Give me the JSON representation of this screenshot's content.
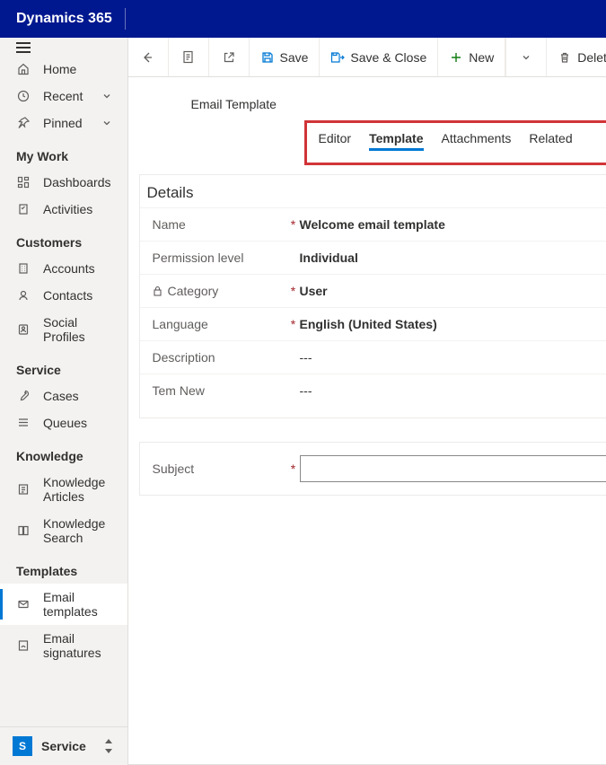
{
  "app_title": "Dynamics 365",
  "sidebar": {
    "top": [
      {
        "label": "Home"
      },
      {
        "label": "Recent",
        "chevron": true
      },
      {
        "label": "Pinned",
        "chevron": true
      }
    ],
    "groups": [
      {
        "title": "My Work",
        "items": [
          {
            "label": "Dashboards"
          },
          {
            "label": "Activities"
          }
        ]
      },
      {
        "title": "Customers",
        "items": [
          {
            "label": "Accounts"
          },
          {
            "label": "Contacts"
          },
          {
            "label": "Social Profiles"
          }
        ]
      },
      {
        "title": "Service",
        "items": [
          {
            "label": "Cases"
          },
          {
            "label": "Queues"
          }
        ]
      },
      {
        "title": "Knowledge",
        "items": [
          {
            "label": "Knowledge Articles"
          },
          {
            "label": "Knowledge Search"
          }
        ]
      },
      {
        "title": "Templates",
        "items": [
          {
            "label": "Email templates",
            "selected": true
          },
          {
            "label": "Email signatures"
          }
        ]
      }
    ],
    "area": {
      "tile": "S",
      "label": "Service"
    }
  },
  "commands": {
    "save": "Save",
    "save_close": "Save & Close",
    "new": "New",
    "delete": "Delete"
  },
  "form": {
    "entity": "Email Template",
    "tabs": [
      {
        "label": "Editor"
      },
      {
        "label": "Template",
        "active": true
      },
      {
        "label": "Attachments"
      },
      {
        "label": "Related"
      }
    ],
    "section_title": "Details",
    "fields": [
      {
        "label": "Name",
        "required": true,
        "value": "Welcome email template"
      },
      {
        "label": "Permission level",
        "required": false,
        "value": "Individual"
      },
      {
        "label": "Category",
        "required": true,
        "value": "User",
        "locked": true
      },
      {
        "label": "Language",
        "required": true,
        "value": "English (United States)"
      },
      {
        "label": "Description",
        "required": false,
        "value": "---"
      },
      {
        "label": "Tem New",
        "required": false,
        "value": "---"
      }
    ],
    "subject": {
      "label": "Subject",
      "required": true,
      "value": ""
    }
  }
}
